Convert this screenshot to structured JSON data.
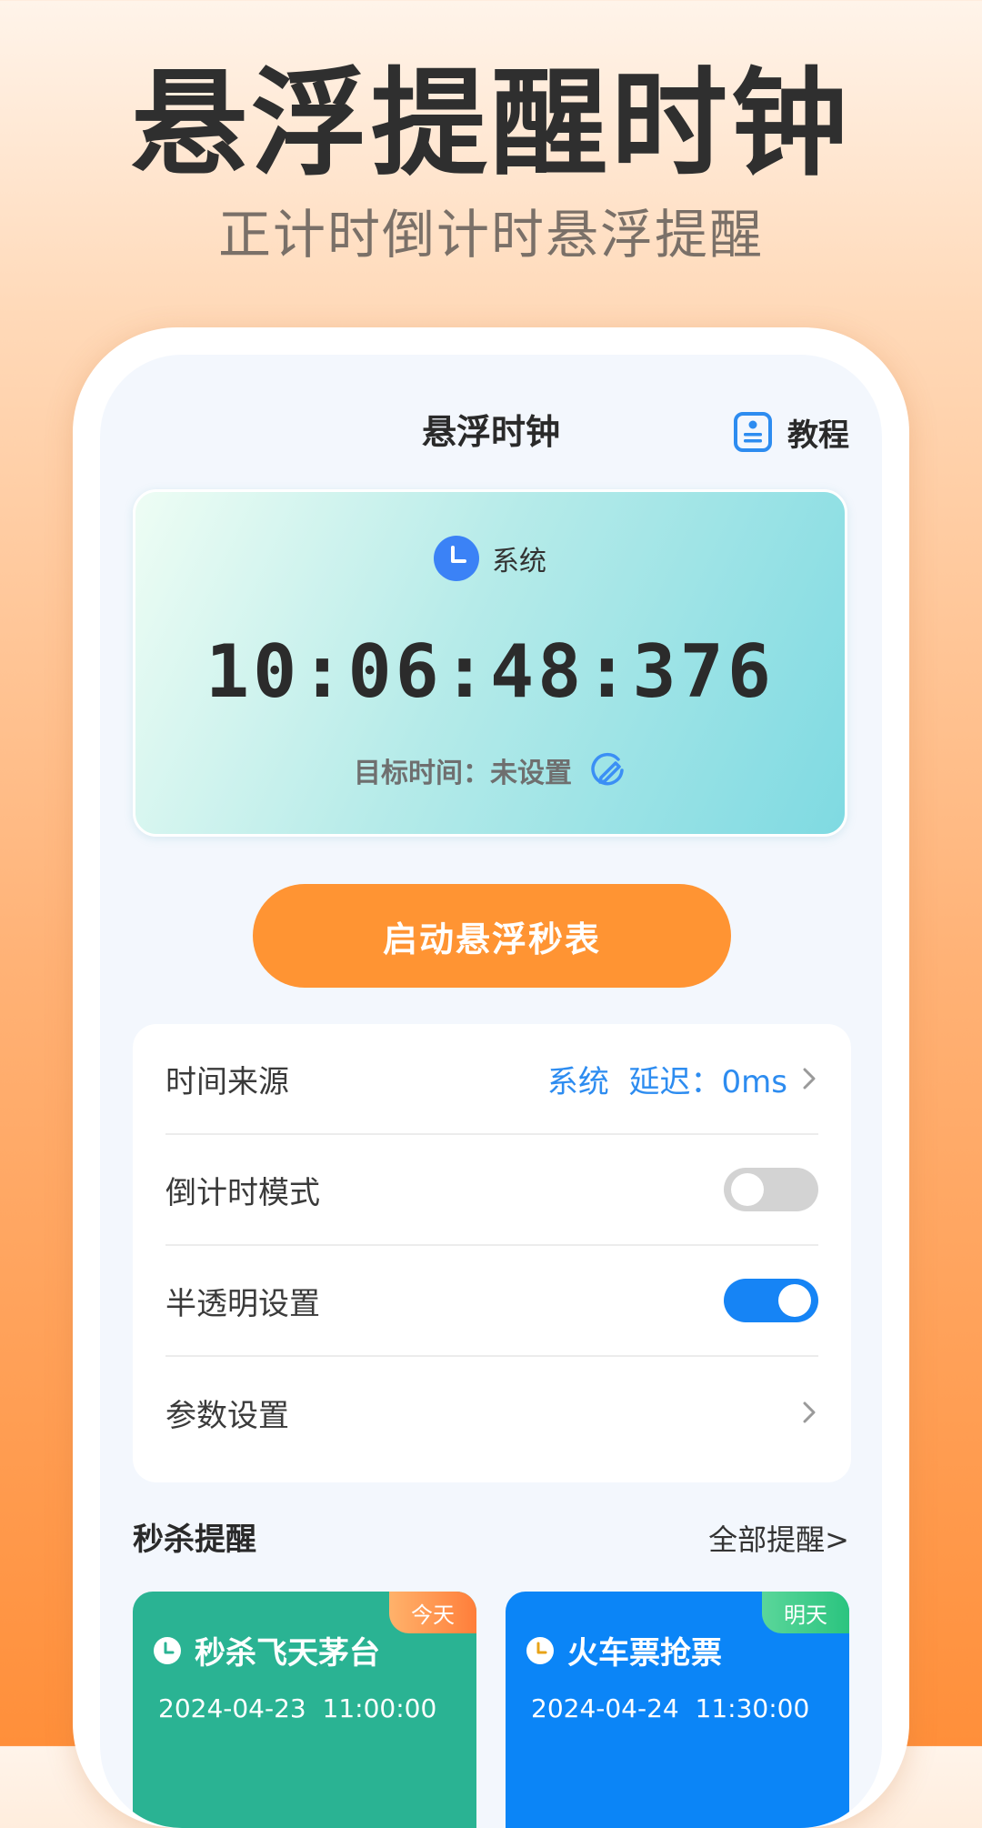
{
  "promo": {
    "title": "悬浮提醒时钟",
    "subtitle": "正计时倒计时悬浮提醒"
  },
  "header": {
    "title": "悬浮时钟",
    "tutorial_label": "教程"
  },
  "clock_card": {
    "source_label": "系统",
    "time": "10:06:48:376",
    "target_label": "目标时间：未设置"
  },
  "start_button_label": "启动悬浮秒表",
  "settings": [
    {
      "label": "时间来源",
      "value": "系统  延迟：0ms",
      "control": "chevron"
    },
    {
      "label": "倒计时模式",
      "control": "toggle",
      "state": "off"
    },
    {
      "label": "半透明设置",
      "control": "toggle",
      "state": "on"
    },
    {
      "label": "参数设置",
      "control": "chevron"
    }
  ],
  "reminders": {
    "section_title": "秒杀提醒",
    "all_link": "全部提醒>",
    "items": [
      {
        "badge": "今天",
        "name": "秒杀飞天茅台",
        "datetime": "2024-04-23  11:00:00"
      },
      {
        "badge": "明天",
        "name": "火车票抢票",
        "datetime": "2024-04-24  11:30:00"
      }
    ]
  },
  "colors": {
    "accent_orange": "#ff9433",
    "accent_blue": "#1684f5",
    "card_green": "#2ab393",
    "card_blue": "#0b85f7"
  },
  "icons": [
    "tutorial-book-icon",
    "clock-icon",
    "edit-icon",
    "chevron-right-icon",
    "small-clock-icon"
  ]
}
